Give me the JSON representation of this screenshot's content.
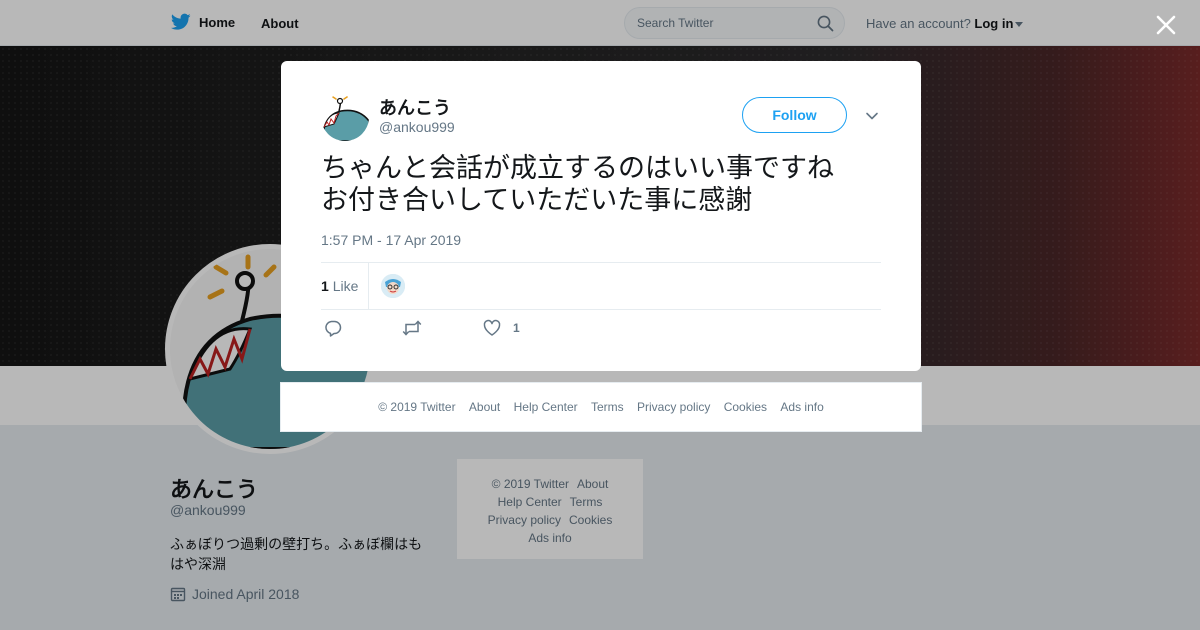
{
  "topbar": {
    "home_label": "Home",
    "about_label": "About",
    "search_placeholder": "Search Twitter",
    "account_prompt": "Have an account?",
    "login_label": "Log in"
  },
  "profile": {
    "name": "あんこう",
    "handle": "@ankou999",
    "bio": "ふぁぼりつ過剰の壁打ち。ふぁぼ欄はもはや深淵",
    "joined": "Joined April 2018"
  },
  "side_footer": {
    "copyright": "© 2019 Twitter",
    "about": "About",
    "help": "Help Center",
    "terms": "Terms",
    "privacy": "Privacy policy",
    "cookies": "Cookies",
    "ads": "Ads info"
  },
  "tweet": {
    "author_name": "あんこう",
    "author_handle": "@ankou999",
    "follow_label": "Follow",
    "text_lines": [
      "ちゃんと会話が成立するのはいい事ですね",
      "お付き合いしていただいた事に感謝"
    ],
    "timestamp": "1:57 PM - 17 Apr 2019",
    "like_count": "1",
    "like_label": "Like",
    "action_like_count": "1"
  },
  "modal_footer": {
    "copyright": "© 2019 Twitter",
    "about": "About",
    "help": "Help Center",
    "terms": "Terms",
    "privacy": "Privacy policy",
    "cookies": "Cookies",
    "ads": "Ads info"
  },
  "colors": {
    "accent": "#1da1f2",
    "text_primary": "#14171a",
    "text_secondary": "#657786",
    "border": "#e6ecf0"
  },
  "icons": {
    "logo": "twitter-bird-icon",
    "search": "search-icon",
    "close": "close-icon",
    "calendar": "calendar-icon",
    "reply": "reply-icon",
    "retweet": "retweet-icon",
    "like": "heart-icon",
    "menu": "chevron-down-icon"
  }
}
